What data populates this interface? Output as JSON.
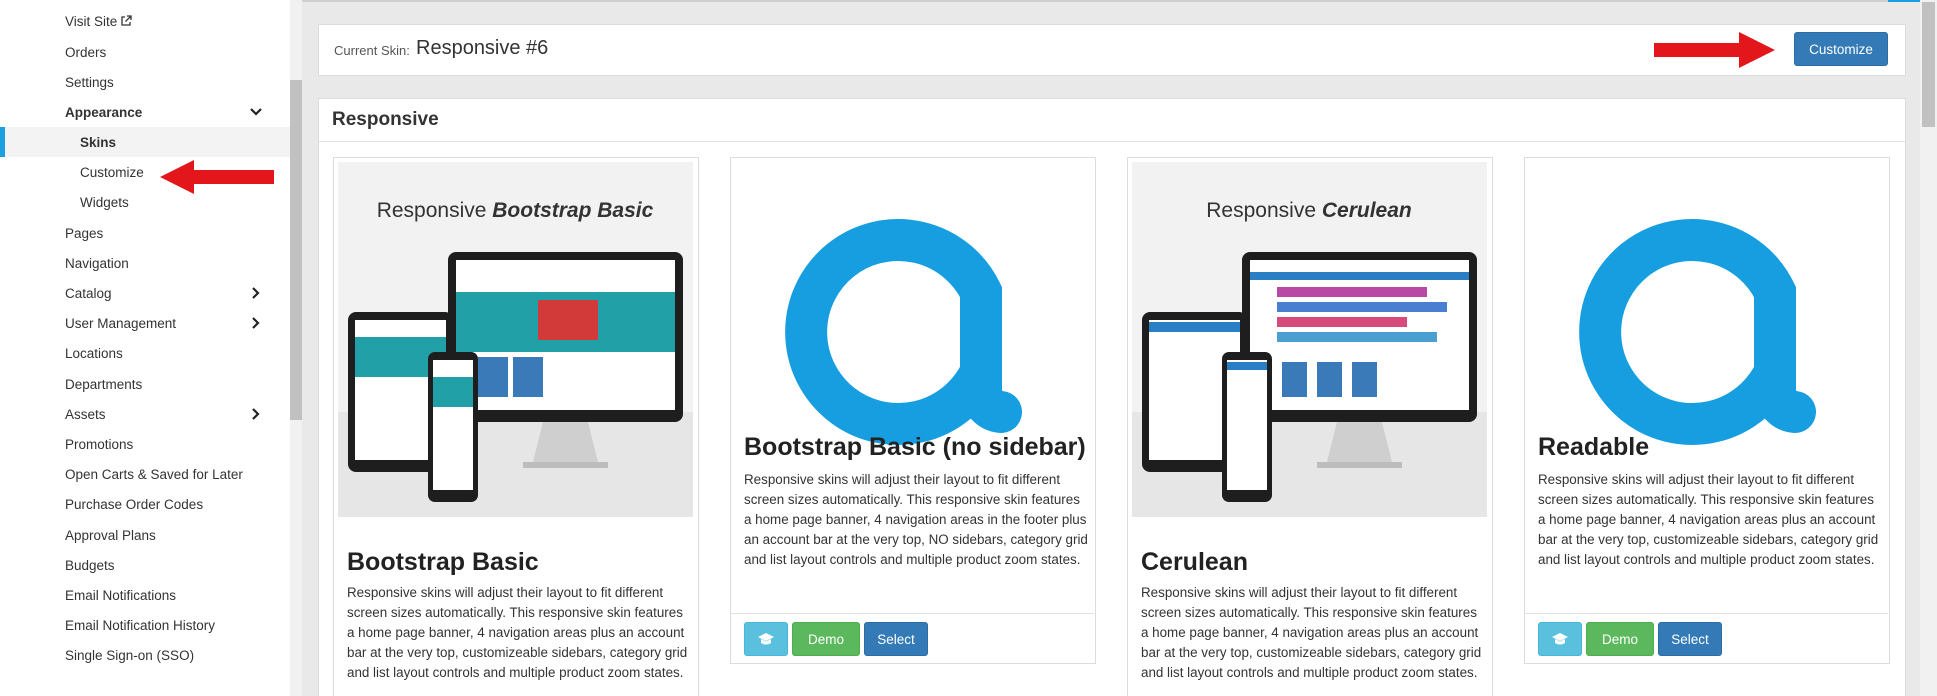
{
  "sidebar": {
    "items": [
      {
        "label": "Visit Site"
      },
      {
        "label": "Orders"
      },
      {
        "label": "Settings"
      },
      {
        "label": "Appearance"
      },
      {
        "label": "Skins"
      },
      {
        "label": "Customize"
      },
      {
        "label": "Widgets"
      },
      {
        "label": "Pages"
      },
      {
        "label": "Navigation"
      },
      {
        "label": "Catalog"
      },
      {
        "label": "User Management"
      },
      {
        "label": "Locations"
      },
      {
        "label": "Departments"
      },
      {
        "label": "Assets"
      },
      {
        "label": "Promotions"
      },
      {
        "label": "Open Carts & Saved for Later"
      },
      {
        "label": "Purchase Order Codes"
      },
      {
        "label": "Approval Plans"
      },
      {
        "label": "Budgets"
      },
      {
        "label": "Email Notifications"
      },
      {
        "label": "Email Notification History"
      },
      {
        "label": "Single Sign-on (SSO)"
      }
    ]
  },
  "current_skin": {
    "label": "Current Skin:",
    "value": "Responsive #6",
    "customize_label": "Customize"
  },
  "section": {
    "title": "Responsive"
  },
  "cards": [
    {
      "image_title_plain": "Responsive",
      "image_title_italic": "Bootstrap Basic",
      "title": "Bootstrap Basic",
      "description": "Responsive skins will adjust their layout to fit different screen sizes automatically. This responsive skin features a home page banner, 4 navigation areas plus an account bar at the very top, customizeable sidebars, category grid and list layout controls and multiple product zoom states."
    },
    {
      "title": "Bootstrap Basic (no sidebar)",
      "description": "Responsive skins will adjust their layout to fit different screen sizes automatically. This responsive skin features a home page banner, 4 navigation areas in the footer plus an account bar at the very top, NO sidebars, category grid and list layout controls and multiple product zoom states.",
      "demo_label": "Demo",
      "select_label": "Select"
    },
    {
      "image_title_plain": "Responsive",
      "image_title_italic": "Cerulean",
      "title": "Cerulean",
      "description": "Responsive skins will adjust their layout to fit different screen sizes automatically. This responsive skin features a home page banner, 4 navigation areas plus an account bar at the very top, customizeable sidebars, category grid and list layout controls and multiple product zoom states."
    },
    {
      "title": "Readable",
      "description": "Responsive skins will adjust their layout to fit different screen sizes automatically. This responsive skin features a home page banner, 4 navigation areas plus an account bar at the very top, customizeable sidebars, category grid and list layout controls and multiple product zoom states.",
      "demo_label": "Demo",
      "select_label": "Select"
    }
  ],
  "colors": {
    "accent": "#1aa0e0",
    "primary": "#337ab7",
    "success": "#5cb85c",
    "info": "#5bc0de",
    "arrow": "#e3161b"
  }
}
